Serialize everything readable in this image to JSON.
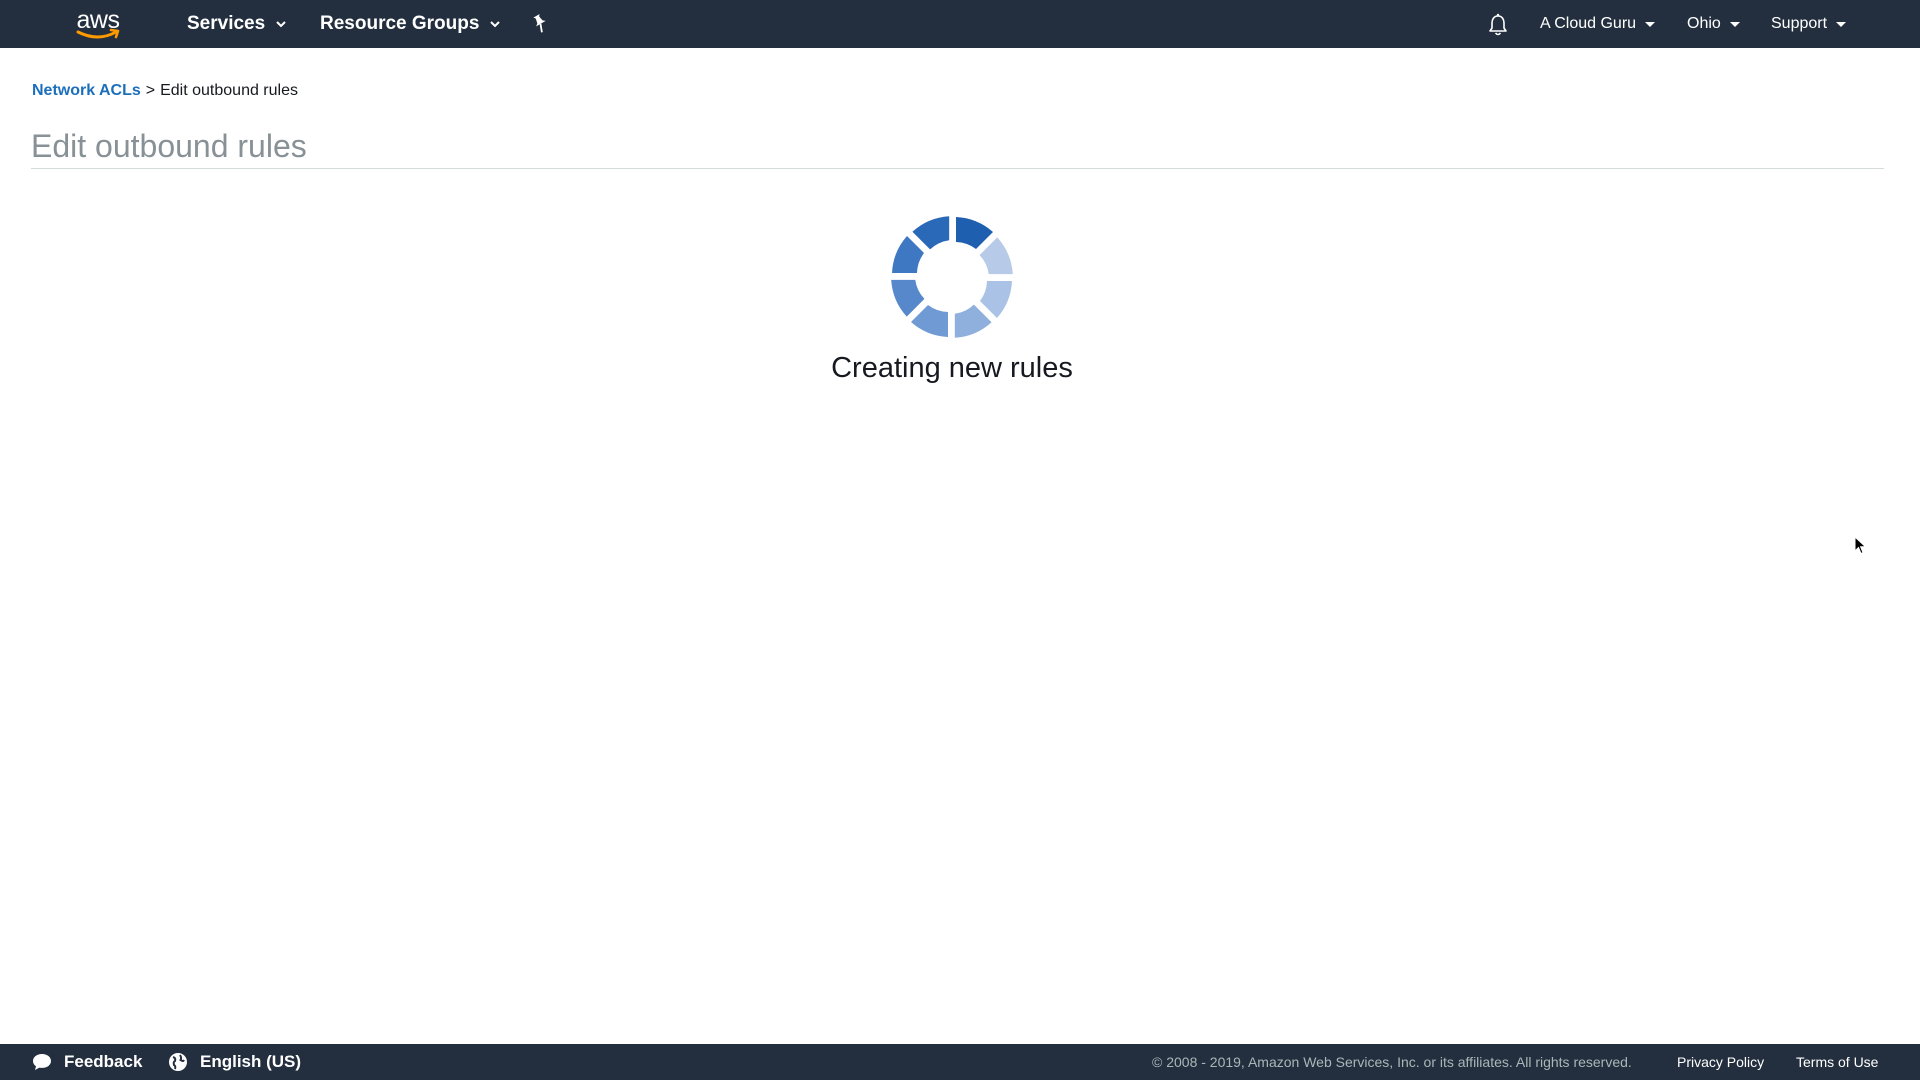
{
  "nav": {
    "logo_text": "aws",
    "services_label": "Services",
    "resource_groups_label": "Resource Groups",
    "account_label": "A Cloud Guru",
    "region_label": "Ohio",
    "support_label": "Support"
  },
  "breadcrumb": {
    "parent_label": "Network ACLs",
    "separator": ">",
    "current_label": "Edit outbound rules"
  },
  "page": {
    "title": "Edit outbound rules"
  },
  "loading": {
    "message": "Creating new rules"
  },
  "footer": {
    "feedback_label": "Feedback",
    "language_label": "English (US)",
    "copyright": "© 2008 - 2019, Amazon Web Services, Inc. or its affiliates. All rights reserved.",
    "privacy_label": "Privacy Policy",
    "terms_label": "Terms of Use"
  },
  "colors": {
    "nav_background": "#232f3e",
    "link_blue": "#1c6fba",
    "spinner_blue": "#2e6fc0",
    "title_gray": "#879196"
  }
}
